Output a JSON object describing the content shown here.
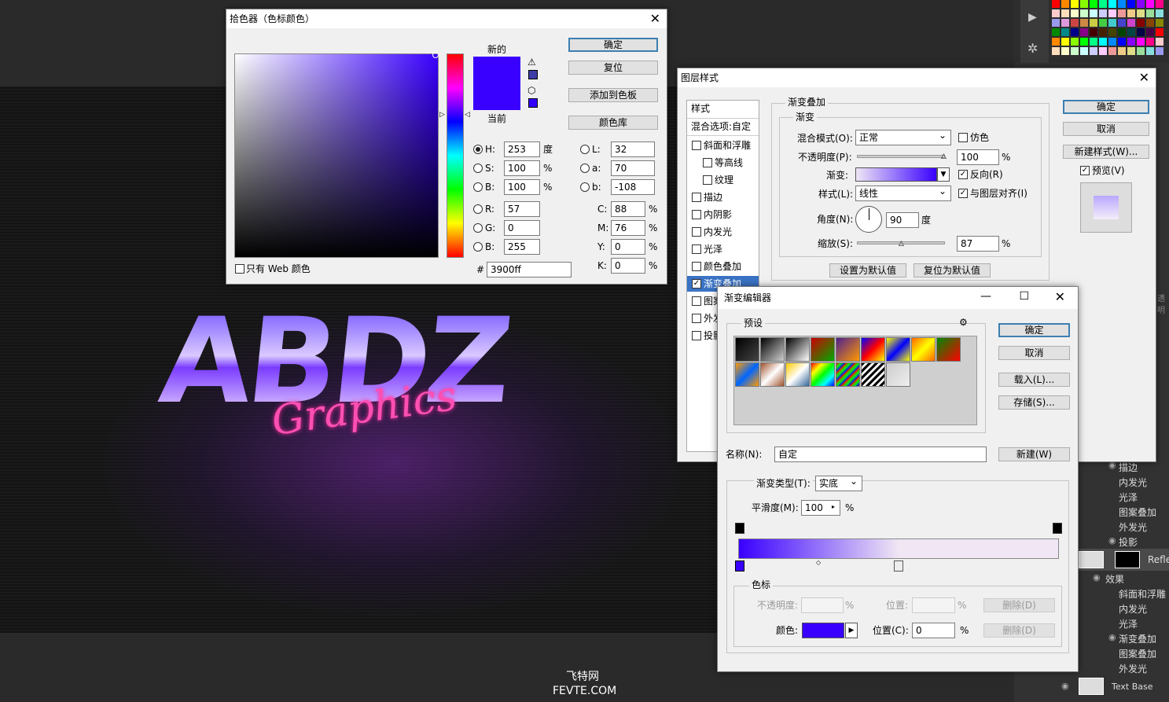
{
  "canvas": {
    "artwork_text": "ABDZ",
    "artwork_script": "Graphics",
    "watermark_line1": "飞特网",
    "watermark_line2": "FEVTE.COM"
  },
  "color_picker": {
    "title": "拾色器（色标颜色）",
    "new_label": "新的",
    "current_label": "当前",
    "ok": "确定",
    "reset": "复位",
    "add_swatch": "添加到色板",
    "color_library": "颜色库",
    "web_only": "只有 Web 颜色",
    "h_label": "H:",
    "h_value": "253",
    "h_unit": "度",
    "s_label": "S:",
    "s_value": "100",
    "s_unit": "%",
    "b_label": "B:",
    "b_value": "100",
    "b_unit": "%",
    "r_label": "R:",
    "r_value": "57",
    "g_label": "G:",
    "g_value": "0",
    "b2_label": "B:",
    "b2_value": "255",
    "l_label": "L:",
    "l_value": "32",
    "a_label": "a:",
    "a_value": "70",
    "lb_label": "b:",
    "lb_value": "-108",
    "c_label": "C:",
    "c_value": "88",
    "m_label": "M:",
    "m_value": "76",
    "y_label": "Y:",
    "y_value": "0",
    "k_label": "K:",
    "k_value": "0",
    "pct": "%",
    "hex_label": "#",
    "hex_value": "3900ff",
    "new_color": "#3900ff",
    "current_color": "#3900ff"
  },
  "layer_style": {
    "title": "图层样式",
    "styles_header": "样式",
    "blend_options": "混合选项:自定",
    "items": [
      {
        "label": "斜面和浮雕",
        "checked": false
      },
      {
        "label": "等高线",
        "checked": false
      },
      {
        "label": "纹理",
        "checked": false
      },
      {
        "label": "描边",
        "checked": false
      },
      {
        "label": "内阴影",
        "checked": false
      },
      {
        "label": "内发光",
        "checked": false
      },
      {
        "label": "光泽",
        "checked": false
      },
      {
        "label": "颜色叠加",
        "checked": false
      },
      {
        "label": "渐变叠加",
        "checked": true
      },
      {
        "label": "图案",
        "checked": false
      },
      {
        "label": "外发",
        "checked": false
      },
      {
        "label": "投影",
        "checked": false
      }
    ],
    "section_title": "渐变叠加",
    "subsection": "渐变",
    "blend_mode_label": "混合模式(O):",
    "blend_mode_value": "正常",
    "dither_label": "仿色",
    "opacity_label": "不透明度(P):",
    "opacity_value": "100",
    "gradient_label": "渐变:",
    "reverse_label": "反向(R)",
    "style_label": "样式(L):",
    "style_value": "线性",
    "align_label": "与图层对齐(I)",
    "angle_label": "角度(N):",
    "angle_value": "90",
    "angle_unit": "度",
    "scale_label": "缩放(S):",
    "scale_value": "87",
    "pct": "%",
    "set_default": "设置为默认值",
    "reset_default": "复位为默认值",
    "ok": "确定",
    "cancel": "取消",
    "new_style": "新建样式(W)...",
    "preview_label": "预览(V)"
  },
  "gradient_editor": {
    "title": "渐变编辑器",
    "presets_label": "预设",
    "ok": "确定",
    "cancel": "取消",
    "load": "载入(L)...",
    "save": "存储(S)...",
    "name_label": "名称(N):",
    "name_value": "自定",
    "new_button": "新建(W)",
    "type_label": "渐变类型(T):",
    "type_value": "实底",
    "smooth_label": "平滑度(M):",
    "smooth_value": "100",
    "pct": "%",
    "stops_label": "色标",
    "opacity_label": "不透明度:",
    "location_label": "位置:",
    "delete_label": "删除(D)",
    "color_label": "颜色:",
    "color_location_label": "位置(C):",
    "color_location_value": "0",
    "stop_color": "#3900ff",
    "end_color": "#f0e6f4"
  },
  "layers_panel": {
    "fx_items_top": [
      "描边",
      "内发光",
      "光泽",
      "图案叠加",
      "外发光",
      "投影"
    ],
    "layer_name": "Refle",
    "effects_label": "效果",
    "fx_items_bottom": [
      "斜面和浮雕",
      "内发光",
      "光泽",
      "渐变叠加",
      "图案叠加",
      "外发光"
    ],
    "base_layer": "Text Base",
    "partial_label": "透明"
  }
}
